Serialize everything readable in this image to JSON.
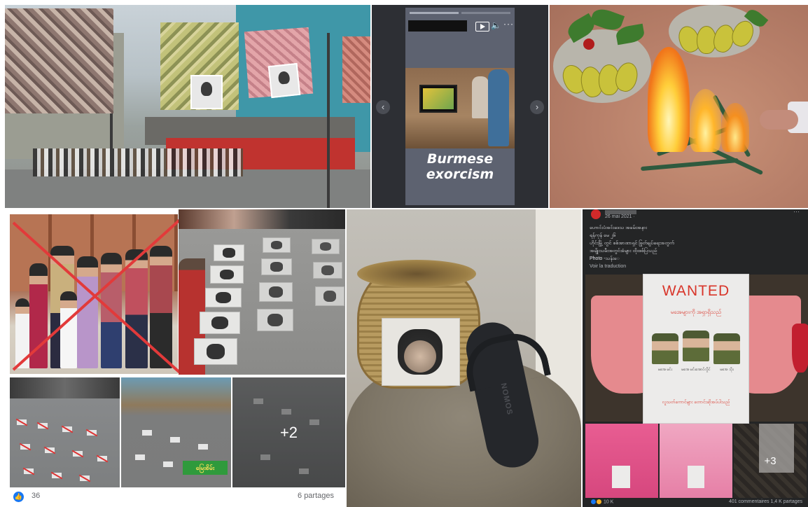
{
  "video": {
    "caption_line1": "Burmese",
    "caption_line2": "exorcism",
    "volume_icon": "speaker-icon",
    "more_icon": "···",
    "prev_icon": "‹",
    "next_icon": "›"
  },
  "social": {
    "more_photos": "+2",
    "shop_banner": "မြေးစိမ်း",
    "like_count": "36",
    "shares": "6 partages"
  },
  "basket": {
    "sandal_brand": "NOMOS"
  },
  "post": {
    "date": "26 mai 2021 ·",
    "lines": [
      "ဟောင်းပံအင်းဒေသ အခမ်းအနား",
      "ရန်ကုန် မေ ၂၆",
      "ဟိုင်းမြို့ တွင် စစ်အာဏာရှင် ဖြုတ်ချပ်ရေးအတွက်",
      "အမျိုးသမီးအတွင်းခံများ ထိုးစစ်ပြသည်",
      "Photo -သန်းေ"
    ],
    "translate": "Voir la traduction",
    "wanted_title": "WANTED",
    "wanted_subtitle": "မအေများကို အရှာရှိသည်",
    "generals": [
      "မအေ မင်း",
      "မအေ မင်းအောင်လှိုင်",
      "မအေ သိုး"
    ],
    "wanted_footer": "လူသတ်ကောင်များ တောင်းဆိုအပ်ပါသည်",
    "more_photos": "+3",
    "reactions": "10 K",
    "comments": "401 commentaires  1,4 K partages"
  },
  "colors": {
    "facebook_blue": "#1877f2",
    "wanted_red": "#d8352a",
    "cross_red": "#e23a3a"
  }
}
